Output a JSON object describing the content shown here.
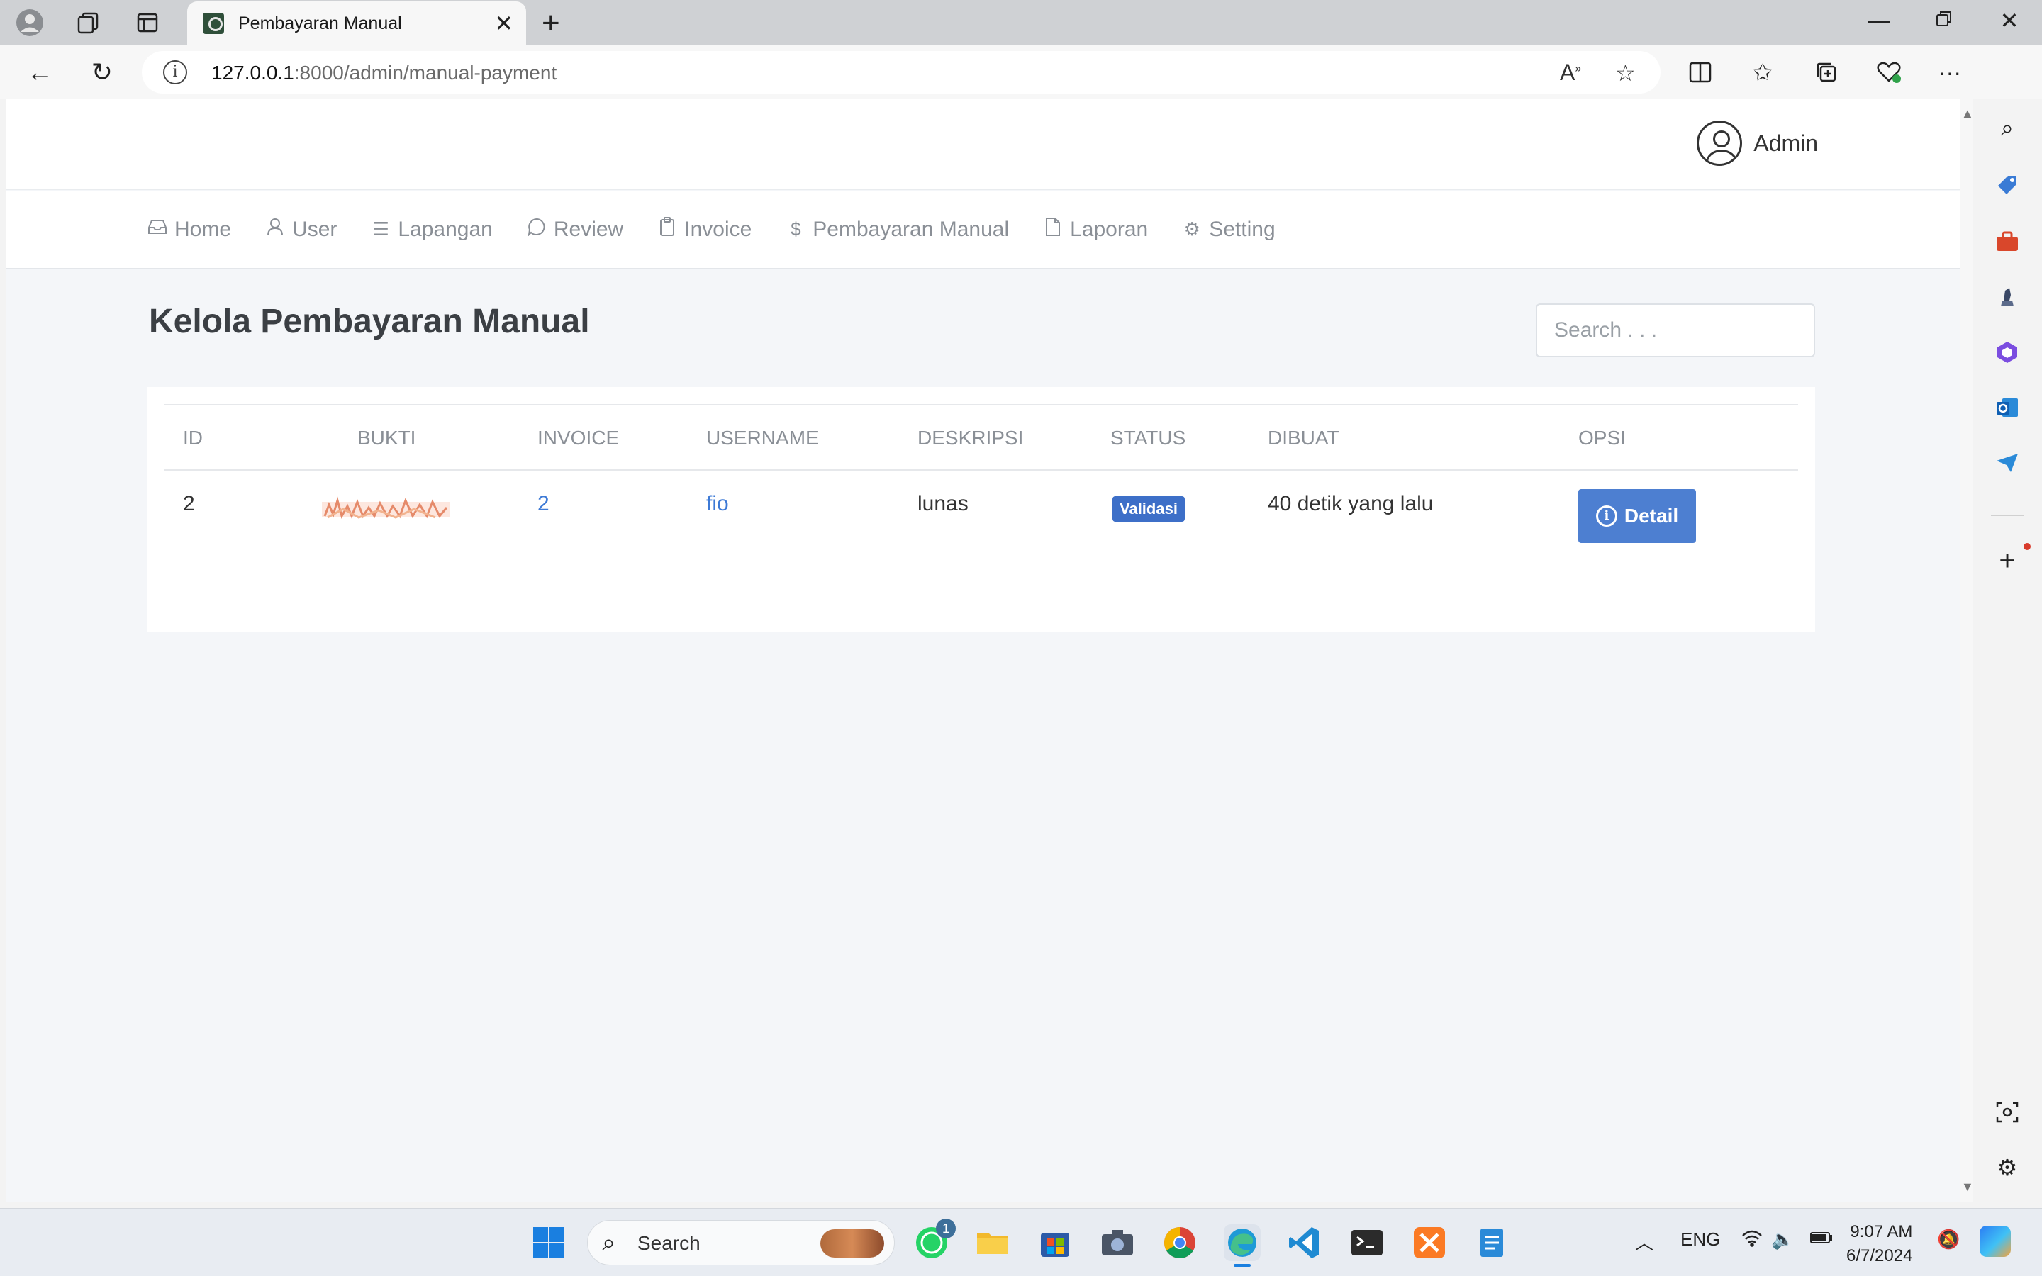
{
  "browser": {
    "tab_title": "Pembayaran Manual",
    "url_host": "127.0.0.1",
    "url_rest": ":8000/admin/manual-payment"
  },
  "header": {
    "user_name": "Admin"
  },
  "menu": [
    {
      "label": "Home",
      "icon": "inbox-icon"
    },
    {
      "label": "User",
      "icon": "user-icon"
    },
    {
      "label": "Lapangan",
      "icon": "list-icon"
    },
    {
      "label": "Review",
      "icon": "chat-icon"
    },
    {
      "label": "Invoice",
      "icon": "clipboard-icon"
    },
    {
      "label": "Pembayaran Manual",
      "icon": "dollar-icon"
    },
    {
      "label": "Laporan",
      "icon": "file-icon"
    },
    {
      "label": "Setting",
      "icon": "gear-icon"
    }
  ],
  "page": {
    "title": "Kelola Pembayaran Manual",
    "search_placeholder": "Search . . ."
  },
  "table": {
    "columns": [
      "ID",
      "BUKTI",
      "INVOICE",
      "USERNAME",
      "DESKRIPSI",
      "STATUS",
      "DIBUAT",
      "OPSI"
    ],
    "rows": [
      {
        "id": "2",
        "invoice": "2",
        "username": "fio",
        "deskripsi": "lunas",
        "status": "Validasi",
        "dibuat": "40 detik yang lalu",
        "action": "Detail"
      }
    ]
  },
  "taskbar": {
    "search_label": "Search",
    "whatsapp_badge": "1",
    "language": "ENG",
    "time": "9:07 AM",
    "date": "6/7/2024"
  },
  "colors": {
    "primary": "#4d7fd1",
    "badge": "#3d6fc8",
    "link": "#3d7ad6",
    "page_bg": "#f4f6f9"
  }
}
